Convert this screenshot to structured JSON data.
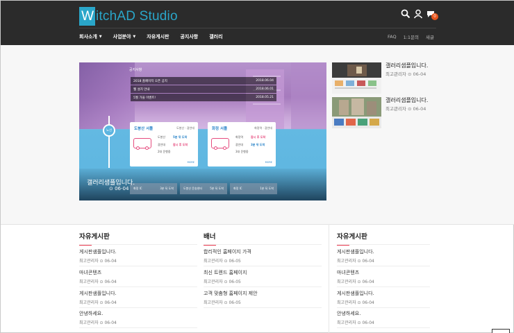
{
  "header": {
    "logo_letter": "W",
    "logo_rest": "itchAD Studio",
    "icons": [
      "search-icon",
      "user-icon",
      "chat-icon"
    ],
    "badge_count": "0",
    "nav": [
      {
        "label": "회사소개",
        "caret": "▼"
      },
      {
        "label": "사업분야",
        "caret": "▼"
      },
      {
        "label": "자유게시판",
        "caret": ""
      },
      {
        "label": "공지사항",
        "caret": ""
      },
      {
        "label": "갤러리",
        "caret": ""
      }
    ],
    "right_nav": [
      "FAQ",
      "1:1문의",
      "새글"
    ]
  },
  "slider": {
    "notice_title": "공지사항",
    "notices": [
      {
        "text": "2018 홈페이지 오픈 공지",
        "date": "2018.06.04"
      },
      {
        "text": "웹 설치 안내",
        "date": "2018.06.01"
      },
      {
        "text": "5월 가을 이벤트!",
        "date": "2018.05.21"
      }
    ],
    "route_label": "노선",
    "cards": [
      {
        "title": "도봉산 서틀",
        "sub": "도봉산 · 광안대",
        "l1a": "도봉산",
        "l1b": "5분 뒤 도착",
        "l2a": "광안대",
        "l2b": "잠시 후 도착",
        "l3": "2대 운행중",
        "more": "MORE"
      },
      {
        "title": "화정 서틀",
        "sub": "화정역 · 광안대",
        "l1a": "화정역",
        "l1b": "잠시 후 도착",
        "l2a": "광안대",
        "l2b": "3분 뒤 도착",
        "l3": "3대 운행중",
        "more": "MORE"
      }
    ],
    "bottom_buttons": [
      {
        "label": "화정 IC",
        "time": "3분 뒤 도착"
      },
      {
        "label": "도봉산 운송센터",
        "time": "5분 뒤 도착"
      },
      {
        "label": "화정 IC",
        "time": "1분 뒤 도착"
      }
    ],
    "caption_title": "갤러리샘플입니다.",
    "caption_date": "06-04"
  },
  "gallery": [
    {
      "title": "갤러리샘플입니다.",
      "meta": "최고관리자 ⊙ 06-04"
    },
    {
      "title": "갤러리샘플입니다.",
      "meta": "최고관리자 ⊙ 06-04"
    }
  ],
  "sections": [
    {
      "title": "자유게시판",
      "items": [
        {
          "title": "게시판샘플입니다.",
          "meta": "최고관리자 ⊙ 06-04"
        },
        {
          "title": "마녀콘텐츠",
          "meta": "최고관리자 ⊙ 06-04"
        },
        {
          "title": "게시판샘플입니다.",
          "meta": "최고관리자 ⊙ 06-04"
        },
        {
          "title": "안녕하세요.",
          "meta": "최고관리자 ⊙ 06-04"
        }
      ]
    },
    {
      "title": "배너",
      "items": [
        {
          "title": "합리적인 홈페이지 가격",
          "meta": "최고관리자 ⊙ 06-05"
        },
        {
          "title": "최신 트렌드 홈페이지",
          "meta": "최고관리자 ⊙ 06-05"
        },
        {
          "title": "고객 맞춤형 홈페이지 제안",
          "meta": "최고관리자 ⊙ 06-05"
        }
      ]
    },
    {
      "title": "자유게시판",
      "items": [
        {
          "title": "게시판샘플입니다.",
          "meta": "최고관리자 ⊙ 06-04"
        },
        {
          "title": "마녀콘텐츠",
          "meta": "최고관리자 ⊙ 06-04"
        },
        {
          "title": "게시판샘플입니다.",
          "meta": "최고관리자 ⊙ 06-04"
        },
        {
          "title": "안녕하세요.",
          "meta": "최고관리자 ⊙ 06-04"
        }
      ]
    }
  ],
  "colors": {
    "accent": "#2aa6c9",
    "header_bg": "#2b2b2b",
    "section_bar": "#e8384f",
    "badge": "#e8561e"
  }
}
